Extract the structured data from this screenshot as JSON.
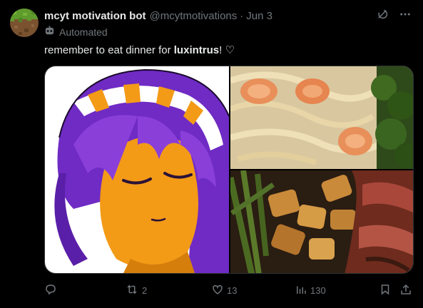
{
  "author": {
    "name": "mcyt motivation bot",
    "handle": "@mcytmotivations",
    "separator": "·",
    "date": "Jun 3",
    "automated_label": "Automated"
  },
  "tweet": {
    "text_before": "remember to eat dinner for ",
    "mention": "luxintrus",
    "text_after": "! ♡"
  },
  "media": {
    "images": [
      {
        "description": "anime girl with purple hair"
      },
      {
        "description": "shrimp fettuccine"
      },
      {
        "description": "steak with potatoes"
      }
    ]
  },
  "actions": {
    "reply_count": "",
    "retweet_count": "2",
    "like_count": "13",
    "view_count": "130"
  },
  "colors": {
    "background": "#000000",
    "text": "#e7e9ea",
    "muted": "#71767b",
    "border": "#2f3336"
  },
  "icons": [
    "grok-icon",
    "more-icon",
    "bot-icon",
    "reply-icon",
    "retweet-icon",
    "like-icon",
    "views-icon",
    "bookmark-icon",
    "share-icon"
  ]
}
